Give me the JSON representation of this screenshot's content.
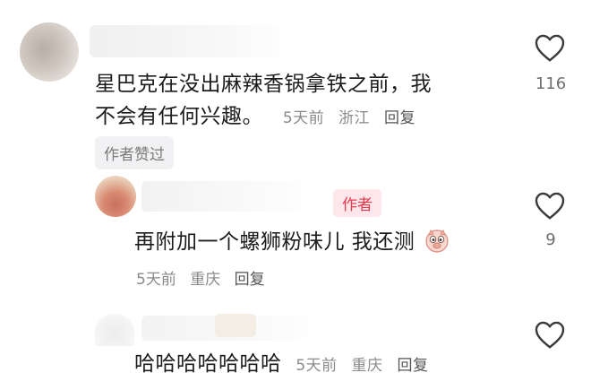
{
  "comments": [
    {
      "text_line1": "星巴克在没出麻辣香锅拿铁之前，我",
      "text_line2": "不会有任何兴趣。",
      "time": "5天前",
      "location": "浙江",
      "reply": "回复",
      "like_count": "116",
      "badge": "作者赞过"
    },
    {
      "author_tag": "作者",
      "text": "再附加一个螺狮粉味儿 我还测",
      "time": "5天前",
      "location": "重庆",
      "reply": "回复",
      "like_count": "9"
    },
    {
      "text": "哈哈哈哈哈哈哈",
      "time": "5天前",
      "location": "重庆",
      "reply": "回复"
    }
  ],
  "icons": {
    "like": "heart-outline-icon",
    "emoji": "pig-face-emoji"
  },
  "colors": {
    "author_tag_bg": "#fde7ea",
    "author_tag_text": "#e8384f",
    "meta_text": "#8a8a8a"
  }
}
